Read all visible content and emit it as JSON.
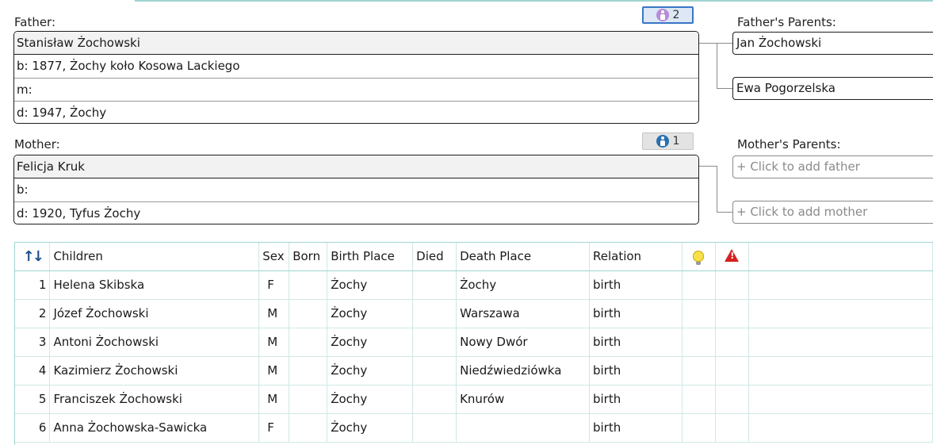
{
  "father": {
    "label": "Father:",
    "badge_count": "2",
    "name": "Stanisław Żochowski",
    "birth": "b: 1877, Żochy koło Kosowa Lackiego",
    "marriage": "m:",
    "death": "d: 1947, Żochy"
  },
  "mother": {
    "label": "Mother:",
    "badge_count": "1",
    "name": "Felicja Kruk",
    "birth": "b:",
    "death": "d: 1920, Tyfus Żochy"
  },
  "father_parents": {
    "label": "Father's Parents:",
    "father": "Jan Żochowski",
    "mother": "Ewa Pogorzelska"
  },
  "mother_parents": {
    "label": "Mother's Parents:",
    "add_father": "+ Click to add father",
    "add_mother": "+ Click to add mother"
  },
  "children_table": {
    "headers": {
      "children": "Children",
      "sex": "Sex",
      "born": "Born",
      "birth_place": "Birth Place",
      "died": "Died",
      "death_place": "Death Place",
      "relation": "Relation"
    },
    "rows": [
      {
        "num": "1",
        "name": "Helena Skibska",
        "sex": "F",
        "born": "",
        "birth_place": "Żochy",
        "died": "",
        "death_place": "Żochy",
        "relation": "birth"
      },
      {
        "num": "2",
        "name": "Józef Żochowski",
        "sex": "M",
        "born": "",
        "birth_place": "Żochy",
        "died": "",
        "death_place": "Warszawa",
        "relation": "birth"
      },
      {
        "num": "3",
        "name": "Antoni Żochowski",
        "sex": "M",
        "born": "",
        "birth_place": "Żochy",
        "died": "",
        "death_place": "Nowy Dwór",
        "relation": "birth"
      },
      {
        "num": "4",
        "name": "Kazimierz Żochowski",
        "sex": "M",
        "born": "",
        "birth_place": "Żochy",
        "died": "",
        "death_place": "Niedźwiedziówka",
        "relation": "birth"
      },
      {
        "num": "5",
        "name": "Franciszek Żochowski",
        "sex": "M",
        "born": "",
        "birth_place": "Żochy",
        "died": "",
        "death_place": "Knurów",
        "relation": "birth"
      },
      {
        "num": "6",
        "name": "Anna Żochowska-Sawicka",
        "sex": "F",
        "born": "",
        "birth_place": "Żochy",
        "died": "",
        "death_place": "",
        "relation": "birth"
      }
    ]
  }
}
